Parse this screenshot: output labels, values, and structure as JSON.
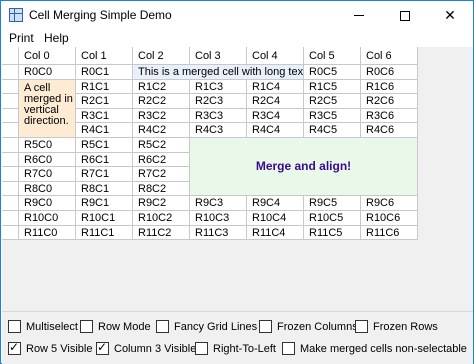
{
  "window": {
    "title": "Cell Merging Simple Demo"
  },
  "menu": {
    "print": "Print",
    "help": "Help"
  },
  "grid": {
    "headers": [
      "Col 0",
      "Col 1",
      "Col 2",
      "Col 3",
      "Col 4",
      "Col 5",
      "Col 6"
    ],
    "rows": [
      [
        "R0C0",
        "R0C1",
        "",
        "",
        "",
        "R0C5",
        "R0C6"
      ],
      [
        "",
        "R1C1",
        "R1C2",
        "R1C3",
        "R1C4",
        "R1C5",
        "R1C6"
      ],
      [
        "",
        "R2C1",
        "R2C2",
        "R2C3",
        "R2C4",
        "R2C5",
        "R2C6"
      ],
      [
        "",
        "R3C1",
        "R3C2",
        "R3C3",
        "R3C4",
        "R3C5",
        "R3C6"
      ],
      [
        "",
        "R4C1",
        "R4C2",
        "R4C3",
        "R4C4",
        "R4C5",
        "R4C6"
      ],
      [
        "R5C0",
        "R5C1",
        "R5C2",
        "",
        "",
        "",
        ""
      ],
      [
        "R6C0",
        "R6C1",
        "R6C2",
        "",
        "",
        "",
        ""
      ],
      [
        "R7C0",
        "R7C1",
        "R7C2",
        "",
        "",
        "",
        ""
      ],
      [
        "R8C0",
        "R8C1",
        "R8C2",
        "",
        "",
        "",
        ""
      ],
      [
        "R9C0",
        "R9C1",
        "R9C2",
        "R9C3",
        "R9C4",
        "R9C5",
        "R9C6"
      ],
      [
        "R10C0",
        "R10C1",
        "R10C2",
        "R10C3",
        "R10C4",
        "R10C5",
        "R10C6"
      ],
      [
        "R11C0",
        "R11C1",
        "R11C2",
        "R11C3",
        "R11C4",
        "R11C5",
        "R11C6"
      ]
    ],
    "merged_long_text": "This is a merged cell with long text.",
    "merged_vertical_text": "A cell merged in vertical direction.",
    "merged_big_text": "Merge and align!"
  },
  "options": {
    "multiselect": {
      "label": "Multiselect",
      "checked": false
    },
    "row_mode": {
      "label": "Row Mode",
      "checked": false
    },
    "fancy_grid_lines": {
      "label": "Fancy Grid Lines",
      "checked": false
    },
    "frozen_columns": {
      "label": "Frozen Columns",
      "checked": false
    },
    "frozen_rows": {
      "label": "Frozen Rows",
      "checked": false
    },
    "row5_visible": {
      "label": "Row 5 Visible",
      "checked": true
    },
    "column3_visible": {
      "label": "Column 3 Visible",
      "checked": true
    },
    "right_to_left": {
      "label": "Right-To-Left",
      "checked": false
    },
    "merged_nonselectable": {
      "label": "Make merged cells non-selectable",
      "checked": false
    }
  },
  "colors": {
    "merged_long_bg": "#e8f1fb",
    "merged_vertical_bg": "#fdebd3",
    "merged_big_bg": "#eaf8ea",
    "merged_big_text": "#3a0a8c"
  }
}
